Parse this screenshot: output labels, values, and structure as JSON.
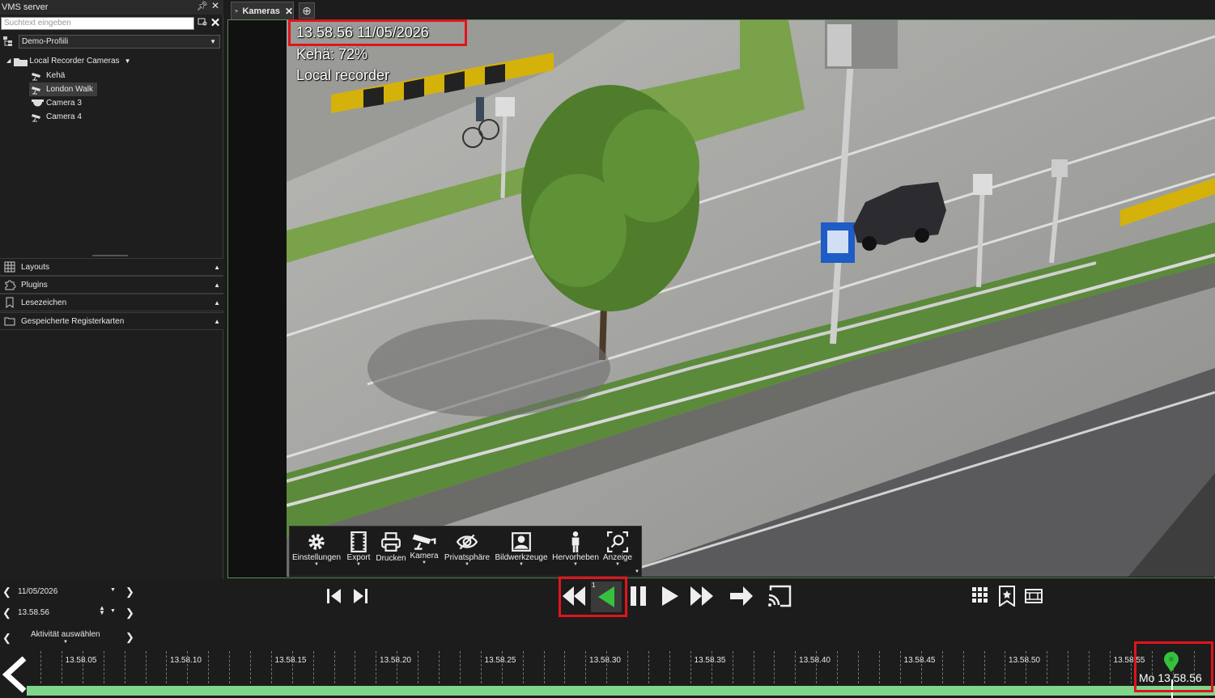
{
  "sidebar": {
    "title": "VMS server",
    "search_placeholder": "Suchtext eingeben",
    "profile": "Demo-Profiili",
    "tree_root": "Local Recorder Cameras",
    "cameras": [
      {
        "label": "Kehä",
        "selected": false
      },
      {
        "label": "London Walk",
        "selected": true
      },
      {
        "label": "Camera 3",
        "selected": false
      },
      {
        "label": "Camera 4",
        "selected": false
      }
    ],
    "panels": [
      "Layouts",
      "Plugins",
      "Lesezeichen",
      "Gespeicherte Registerkarten"
    ]
  },
  "tabs": {
    "active": "Kameras"
  },
  "overlay": {
    "timestamp": "13.58.56  11/05/2026",
    "camera_name": "Kehä: 72%",
    "source": "Local recorder"
  },
  "toolbar": {
    "buttons": [
      "Einstellungen",
      "Export",
      "Drucken",
      "Kamera",
      "Privatsphäre",
      "Bildwerkzeuge",
      "Hervorheben",
      "Anzeige"
    ]
  },
  "nav": {
    "date": "11/05/2026",
    "time": "13.58.56",
    "activity": "Aktivität auswählen"
  },
  "playback": {
    "speed_badge": "1"
  },
  "timeline": {
    "labels": [
      "13.58.05",
      "13.58.10",
      "13.58.15",
      "13.58.20",
      "13.58.25",
      "13.58.30",
      "13.58.35",
      "13.58.40",
      "13.58.45",
      "13.58.50",
      "13.58.55"
    ],
    "current": "Mo 13.58.56"
  },
  "colors": {
    "accent_green": "#35c13e",
    "highlight_red": "#e0141e",
    "timeline_green": "#7fd58a"
  }
}
